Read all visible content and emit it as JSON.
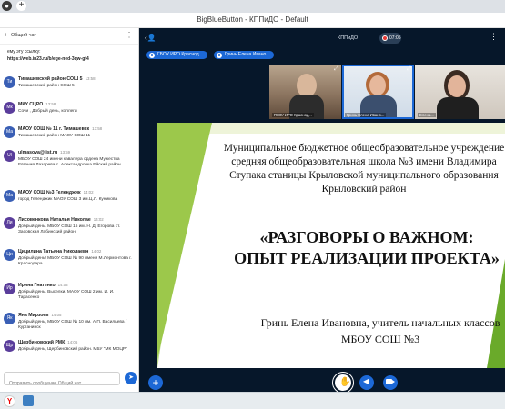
{
  "browser": {
    "tab_icon": "globe-icon",
    "new_tab": "+"
  },
  "window": {
    "title": "BigBlueButton - КППиДО - Default"
  },
  "chat": {
    "title": "Общий чат",
    "link_line1": "ему эту ссылку:",
    "link_line2": "https://web.in23.ru/b/ege-ned-3qw-gf4",
    "input_placeholder": "Отправить сообщение Общий чат",
    "messages": [
      {
        "initials": "Ти",
        "name": "Тимашевский район СОШ 5",
        "time": "13:58",
        "text": "Тимашевский район СОШ 5",
        "color": "#3a5fb5"
      },
      {
        "initials": "Мк",
        "name": "МКУ СЦРО",
        "time": "13:58",
        "text": "Сочи , Добрый день, коллеги",
        "color": "#5a3d9b"
      },
      {
        "initials": "Ма",
        "name": "МАОУ СОШ № 11 г. Тимашевск",
        "time": "13:58",
        "text": "Тимашевский район МАОУ СОШ 11",
        "color": "#3a5fb5"
      },
      {
        "initials": "Ul",
        "name": "ulmasova@list.ru",
        "time": "13:59",
        "text": "МБОУ СОШ 24 имени кавалера ордена Мужества Евгения Лазарева с. Александровка Ейский район",
        "color": "#5a3d9b"
      },
      {
        "initials": "Ма",
        "name": "МАОУ СОШ №3 Геленджик",
        "time": "14:02",
        "text": "город Геленджик МАОУ СОШ 3 им.Ц.Л. Куникова",
        "color": "#3a5fb5"
      },
      {
        "initials": "Ли",
        "name": "Лисовенкова Наталья Николае",
        "time": "14:02",
        "text": "Добрый день. МБОУ СОШ 15 им. Н. Д. Егорова ст. Засовская Лабинский район",
        "color": "#5a3d9b"
      },
      {
        "initials": "Ци",
        "name": "Цицилина Татьяна Николаевн",
        "time": "14:02",
        "text": "Добрый день! МБОУ СОШ № 90 имени М.Лермонтова г. Краснодара",
        "color": "#3a5fb5"
      },
      {
        "initials": "Ир",
        "name": "Ирина Гнатенко",
        "time": "14:03",
        "text": "Добрый день. Выселки. МАОУ СОШ 2 им. И. И. Тарасенко",
        "color": "#5a3d9b"
      },
      {
        "initials": "Як",
        "name": "Яна Мирзоев",
        "time": "14:05",
        "text": "Добрый день, МБОУ СОШ № 10 им. А.П. Васильева / Курганинск",
        "color": "#3a5fb5"
      },
      {
        "initials": "Щр",
        "name": "Щербиновский РМК",
        "time": "14:06",
        "text": "Добрый день, Щербиновский район. МБУ \"МК МОЦР\"",
        "color": "#5a3d9b"
      }
    ]
  },
  "meeting": {
    "room_name": "КППиДО",
    "recording_time": "07:05",
    "speakers": [
      "ГБОУ ИРО Краснод...",
      "Гринь Елена Ивано..."
    ],
    "videos": [
      {
        "label": "ГБОУ ИРО Краснод..."
      },
      {
        "label": "Гринь Елена Ивано..."
      },
      {
        "label": "Елена..."
      }
    ],
    "slide": {
      "school_lines": [
        "Муниципальное бюджетное общеобразовательное учреждение",
        "средняя общеобразовательная школа №3 имени Владимира",
        "Ступака станицы Крыловской муниципального образования",
        "Крыловский район"
      ],
      "headline_lines": [
        "«РАЗГОВОРЫ О ВАЖНОМ:",
        "ОПЫТ РЕАЛИЗАЦИИ ПРОЕКТА»"
      ],
      "author_lines": [
        "Гринь Елена Ивановна, учитель начальных классов",
        "МБОУ СОШ №3"
      ]
    }
  },
  "colors": {
    "accent": "#1c68d6",
    "meeting_bg": "#06172a",
    "record": "#e53935"
  }
}
